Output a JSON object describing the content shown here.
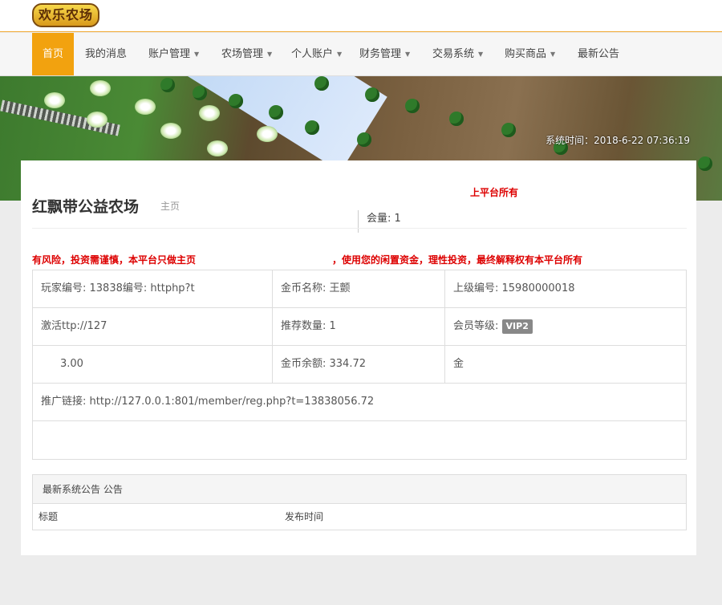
{
  "logo": {
    "text": "欢乐农场"
  },
  "nav": {
    "items": [
      {
        "label": "首页",
        "dropdown": false
      },
      {
        "label": "我的消息",
        "dropdown": false
      },
      {
        "label": "账户管理",
        "dropdown": true
      },
      {
        "label": "农场管理",
        "dropdown": true
      },
      {
        "label": "个人账户",
        "dropdown": true
      },
      {
        "label": "财务管理",
        "dropdown": true
      },
      {
        "label": "交易系统",
        "dropdown": true
      },
      {
        "label": "购买商品",
        "dropdown": true
      },
      {
        "label": "最新公告",
        "dropdown": false
      }
    ]
  },
  "banner": {
    "system_time": "系统时间：2018-6-22 07:36:19"
  },
  "page": {
    "title": "红飘带公益农场",
    "subtitle": "主页",
    "top_note": "上平台所有",
    "count": "会量: 1",
    "warning": "有风险，投资需谨慎，本平台只做主页",
    "warning_right": "，使用您的闲置资金，理性投资，最终解释权有本平台所有"
  },
  "info": {
    "player_no": "玩家编号: 13838编号: httphp?t",
    "coin_name": "金币名称: 王颤",
    "upline_no": "上级编号: 15980000018",
    "activation": "激活ttp://127",
    "referral_count": "推荐数量: 1",
    "member_level_label": "会员等级:",
    "member_level_value": "VIP2",
    "deposit": "3.00",
    "coin_balance": "金币余额: 334.72",
    "other": "金",
    "promo_link": "推广链接: http://127.0.0.1:801/member/reg.php?t=13838056.72"
  },
  "notices": {
    "heading": "最新系统公告 公告",
    "col_title": "标题",
    "col_time": "发布时间"
  },
  "colors": {
    "accent": "#f2a20f",
    "warning": "#d00000",
    "vip_badge": "#888888"
  }
}
